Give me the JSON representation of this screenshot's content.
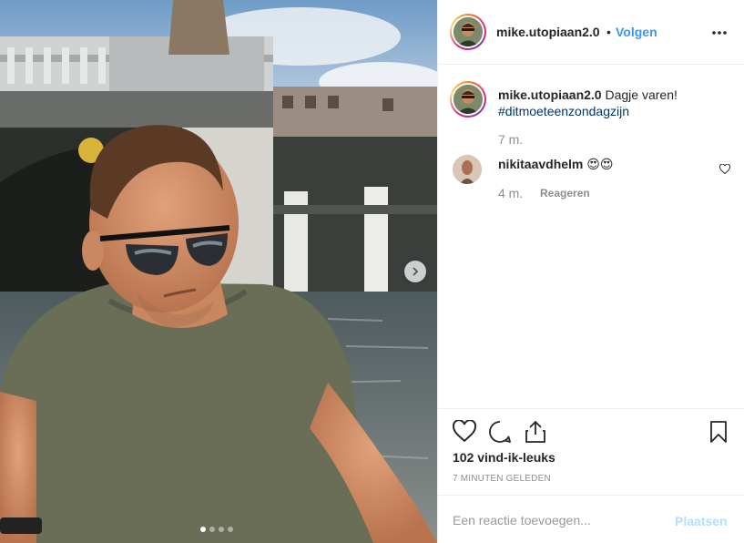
{
  "post": {
    "username": "mike.utopiaan2.0",
    "bullet": "•",
    "follow_label": "Volgen",
    "more_icon": "more-icon"
  },
  "caption": {
    "username": "mike.utopiaan2.0",
    "text": "Dagje varen!",
    "hashtag": "#ditmoeteenzondagzijn",
    "time": "7 m."
  },
  "comments": [
    {
      "username": "nikitaavdhelm",
      "text": "😍😍",
      "time": "4 m.",
      "reply_label": "Reageren"
    }
  ],
  "actions": {
    "like_icon": "heart-icon",
    "comment_icon": "comment-icon",
    "share_icon": "share-icon",
    "save_icon": "bookmark-icon"
  },
  "likes_text": "102 vind-ik-leuks",
  "posted_text": "7 minuten geleden",
  "comment_box": {
    "placeholder": "Een reactie toevoegen...",
    "post_label": "Plaatsen"
  },
  "carousel": {
    "current": 1,
    "total": 4
  },
  "colors": {
    "link": "#3897f0",
    "muted": "#8e8e8e",
    "post_disabled": "#b2dffc"
  }
}
